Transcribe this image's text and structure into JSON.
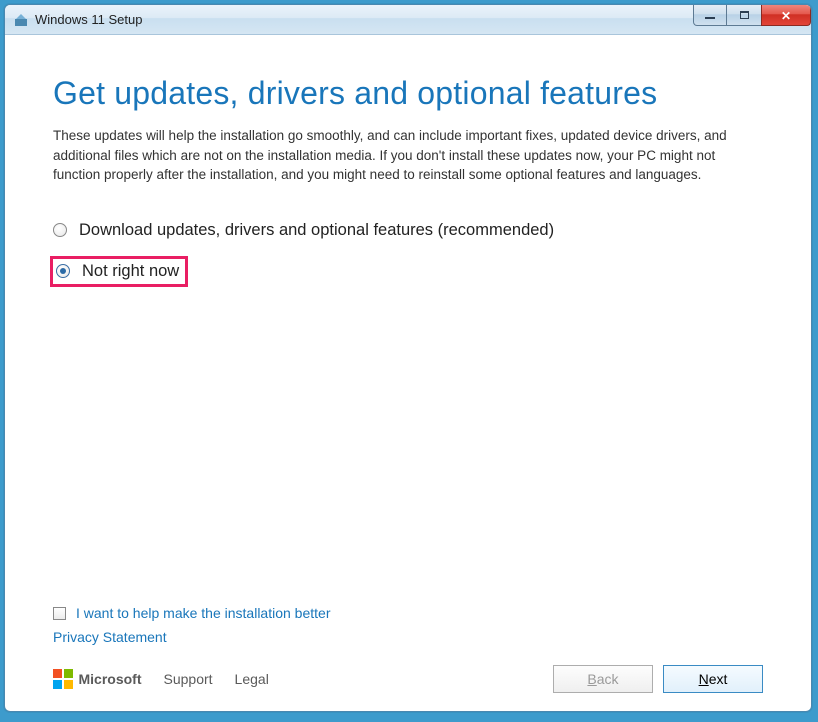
{
  "window": {
    "title": "Windows 11 Setup"
  },
  "main": {
    "heading": "Get updates, drivers and optional features",
    "description": "These updates will help the installation go smoothly, and can include important fixes, updated device drivers, and additional files which are not on the installation media. If you don't install these updates now, your PC might not function properly after the installation, and you might need to reinstall some optional features and languages."
  },
  "options": [
    {
      "label": "Download updates, drivers and optional features (recommended)",
      "selected": false,
      "highlighted": false
    },
    {
      "label": "Not right now",
      "selected": true,
      "highlighted": true
    }
  ],
  "checkbox": {
    "label": "I want to help make the installation better",
    "checked": false
  },
  "links": {
    "privacy": "Privacy Statement",
    "support": "Support",
    "legal": "Legal"
  },
  "brand": {
    "name": "Microsoft"
  },
  "buttons": {
    "back": "Back",
    "next": "Next"
  }
}
